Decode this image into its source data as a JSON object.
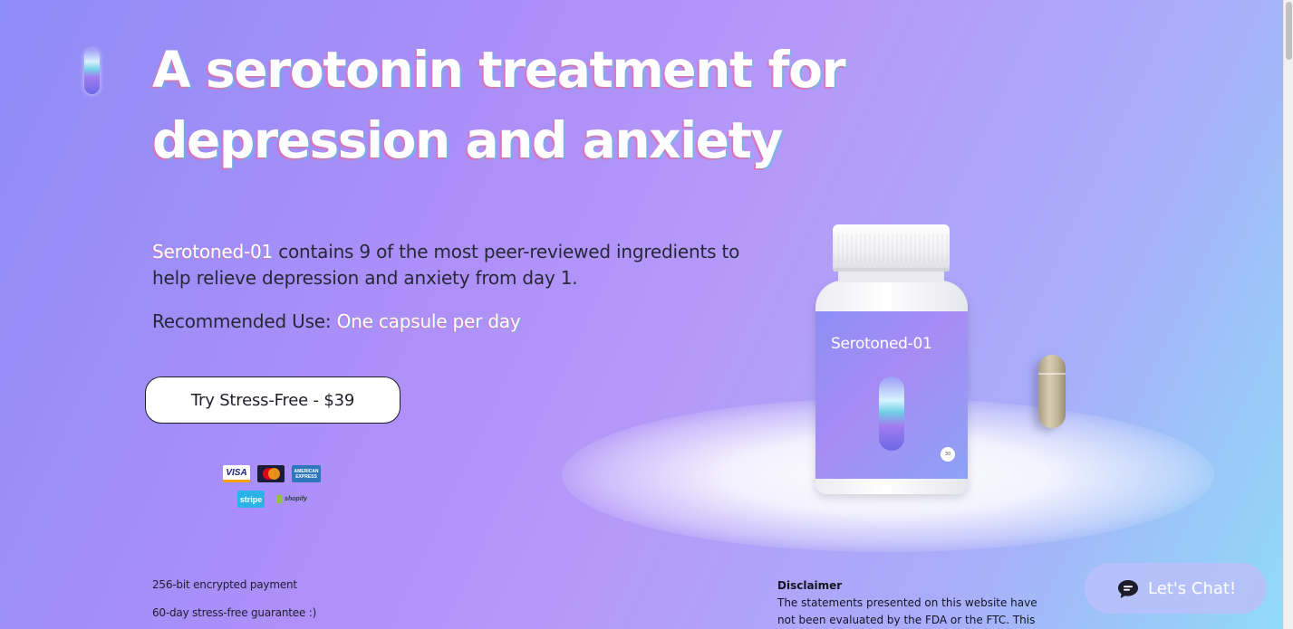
{
  "hero": {
    "headline_line1": "A serotonin treatment for",
    "headline_line2": "depression and anxiety",
    "intro_highlight": "Serotoned-01",
    "intro_text": " contains 9 of the most peer-reviewed ingredients to help relieve depression and anxiety from day 1.",
    "recommend_label": "Recommended Use: ",
    "recommend_value": "One capsule per day",
    "cta_label": "Try Stress-Free - $39"
  },
  "payments": {
    "visa": "VISA",
    "amex": "AMERICAN EXPRESS",
    "stripe": "stripe",
    "shopify": "shopify"
  },
  "footer": {
    "line1": "256-bit encrypted payment",
    "line2": "60-day stress-free guarantee :)",
    "disclaimer_title": "Disclaimer",
    "disclaimer_text": "The statements presented on this website have not been evaluated by the FDA or the FTC. This"
  },
  "product": {
    "bottle_label": "Serotoned-01",
    "badge": "30"
  },
  "chat": {
    "label": "Let's Chat!"
  },
  "icons": {
    "logo": "pill-logo-icon",
    "chat": "chat-bubble-icon"
  }
}
